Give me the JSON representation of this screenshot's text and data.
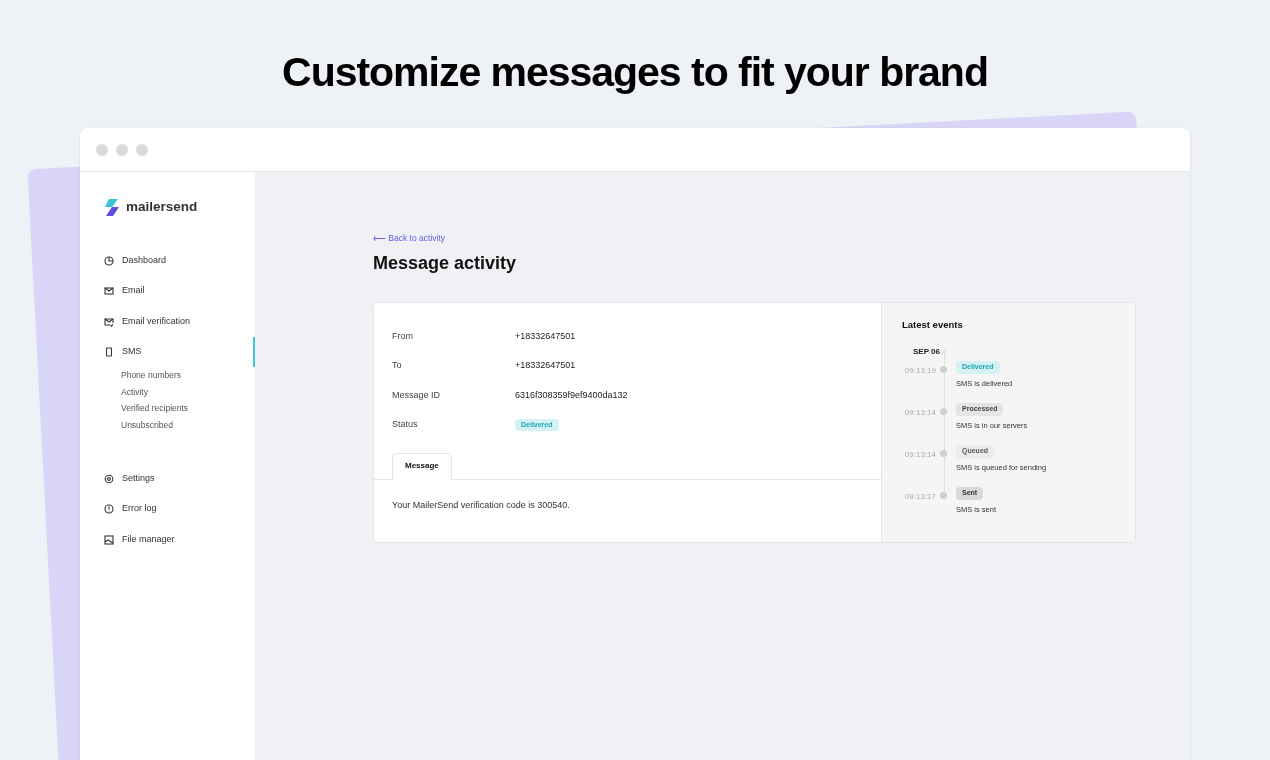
{
  "headline": "Customize messages to fit your brand",
  "logo": {
    "text": "mailersend"
  },
  "sidebar": {
    "items": [
      {
        "label": "Dashboard",
        "selected": false
      },
      {
        "label": "Email",
        "selected": false
      },
      {
        "label": "Email verification",
        "selected": false
      },
      {
        "label": "SMS",
        "selected": true,
        "children": [
          {
            "label": "Phone numbers"
          },
          {
            "label": "Activity"
          },
          {
            "label": "Verified recipients"
          },
          {
            "label": "Unsubscribed"
          }
        ]
      },
      {
        "label": "Settings",
        "selected": false
      },
      {
        "label": "Error log",
        "selected": false
      },
      {
        "label": "File manager",
        "selected": false
      }
    ]
  },
  "back_link": "⟵ Back to activity",
  "page_title": "Message activity",
  "details": [
    {
      "label": "From",
      "value": "+18332647501"
    },
    {
      "label": "To",
      "value": "+18332647501"
    },
    {
      "label": "Message ID",
      "value": "6316f308359f9ef9400da132"
    },
    {
      "label": "Status",
      "badge": "Delivered",
      "kind": "delivered"
    }
  ],
  "tabs": [
    {
      "label": "Message",
      "selected": true
    }
  ],
  "message_body": "Your MailerSend verification code is 300540.",
  "latest_events": {
    "title": "Latest events",
    "date": "SEP 06",
    "events": [
      {
        "time": "09:13:19",
        "badge": "Delivered",
        "kind": "delivered",
        "description": "SMS is delivered"
      },
      {
        "time": "09:13:14",
        "badge": "Processed",
        "kind": "neutral",
        "description": "SMS is in our servers"
      },
      {
        "time": "09:13:14",
        "badge": "Queued",
        "kind": "light",
        "description": "SMS is queued for sending"
      },
      {
        "time": "09:13:17",
        "badge": "Sent",
        "kind": "dark",
        "description": "SMS is sent"
      }
    ]
  }
}
